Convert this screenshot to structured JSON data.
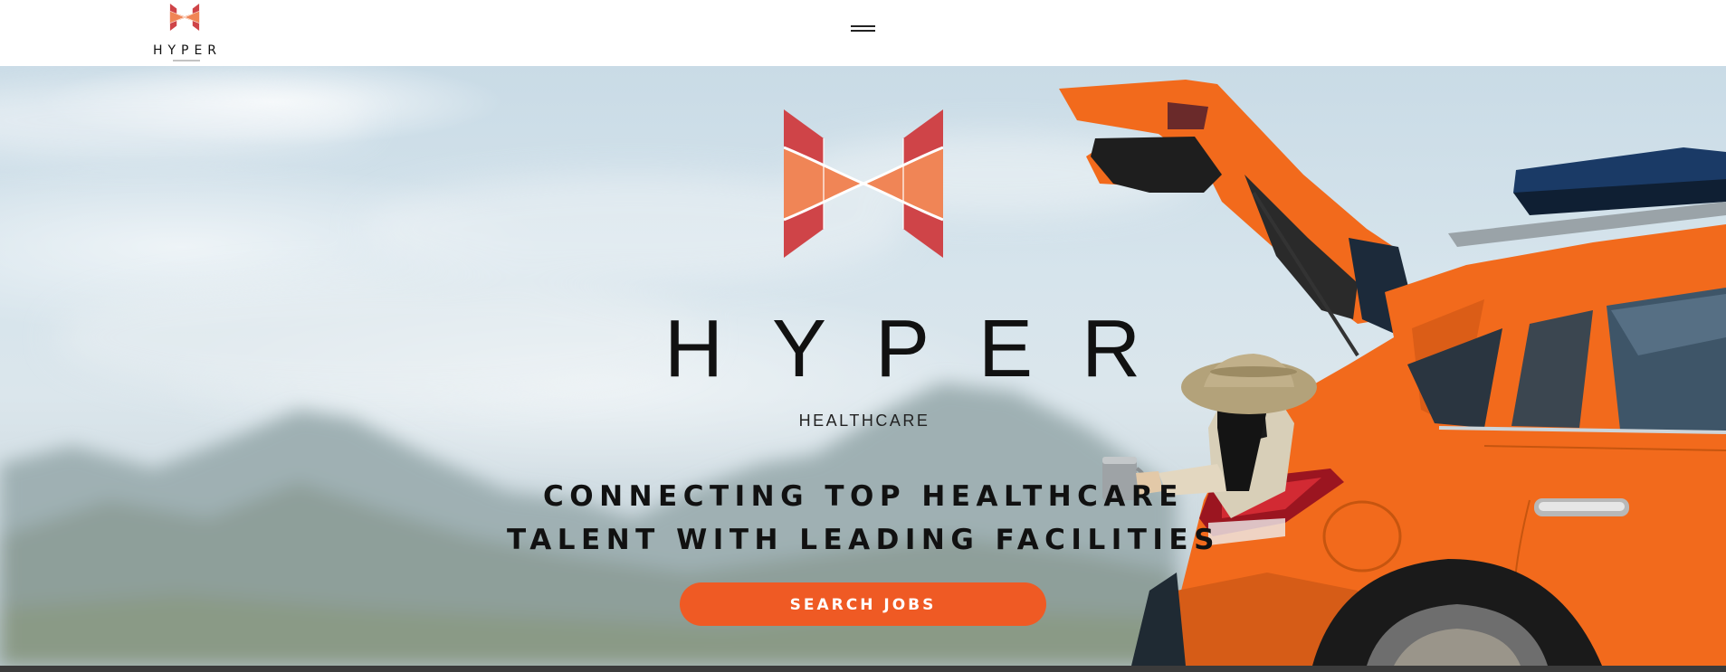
{
  "header": {
    "logo_wordmark": "HYPER",
    "menu_icon": "hamburger-menu-icon"
  },
  "hero": {
    "brand_name": "HYPER",
    "brand_subtitle": "HEALTHCARE",
    "tagline_line1": "CONNECTING TOP HEALTHCARE",
    "tagline_line2": "TALENT WITH LEADING FACILITIES",
    "cta_label": "SEARCH JOBS",
    "background_image": "woman-with-coffee-sitting-in-orange-suv-trunk"
  },
  "colors": {
    "brand_red": "#cf4448",
    "brand_orange": "#f08556",
    "cta": "#ef5a24",
    "car_orange": "#f26a1c"
  }
}
